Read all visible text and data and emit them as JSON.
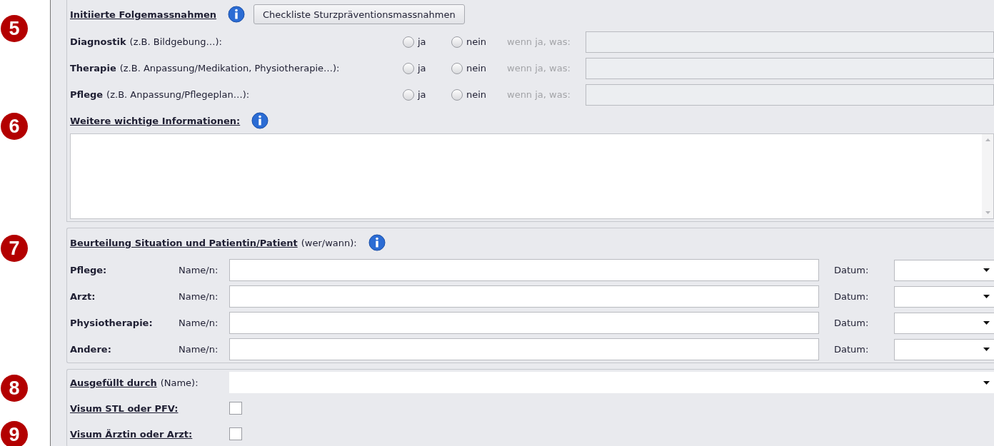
{
  "followup": {
    "marker": "5",
    "title": "Initiierte Folgemassnahmen",
    "checklist_button": "Checkliste Sturzpräventionsmassnahmen",
    "rows": [
      {
        "label": "Diagnostik",
        "hint": "(z.B. Bildgebung…):",
        "options": [
          {
            "label": "ja",
            "selected": false
          },
          {
            "label": "nein",
            "selected": false
          }
        ],
        "detail_label": "wenn ja, was:",
        "detail_disabled": true
      },
      {
        "label": "Therapie",
        "hint": "(z.B. Anpassung/Medikation, Physiotherapie…):",
        "options": [
          {
            "label": "ja",
            "selected": false
          },
          {
            "label": "nein",
            "selected": false
          }
        ],
        "detail_label": "wenn ja, was:",
        "detail_disabled": true
      },
      {
        "label": "Pflege",
        "hint": "(z.B. Anpassung/Pflegeplan…):",
        "options": [
          {
            "label": "ja",
            "selected": false
          },
          {
            "label": "nein",
            "selected": false
          }
        ],
        "detail_label": "wenn ja, was:",
        "detail_disabled": true
      }
    ]
  },
  "info": {
    "marker": "6",
    "title": "Weitere wichtige Informationen:"
  },
  "assessment": {
    "marker": "7",
    "title": "Beurteilung Situation und Patientin/Patient",
    "hint": "(wer/wann):",
    "rows": [
      {
        "role": "Pflege:",
        "name_label": "Name/n:",
        "date_label": "Datum:"
      },
      {
        "role": "Arzt:",
        "name_label": "Name/n:",
        "date_label": "Datum:"
      },
      {
        "role": "Physiotherapie:",
        "name_label": "Name/n:",
        "date_label": "Datum:"
      },
      {
        "role": "Andere:",
        "name_label": "Name/n:",
        "date_label": "Datum:"
      }
    ]
  },
  "signoff": {
    "marker": "8",
    "filled_by": {
      "title": "Ausgefüllt durch",
      "hint": "(Name):"
    },
    "visa": [
      {
        "label": "Visum STL oder PFV:",
        "checked": false
      },
      {
        "marker": "9",
        "label": "Visum Ärztin oder Arzt:",
        "checked": false
      }
    ]
  }
}
